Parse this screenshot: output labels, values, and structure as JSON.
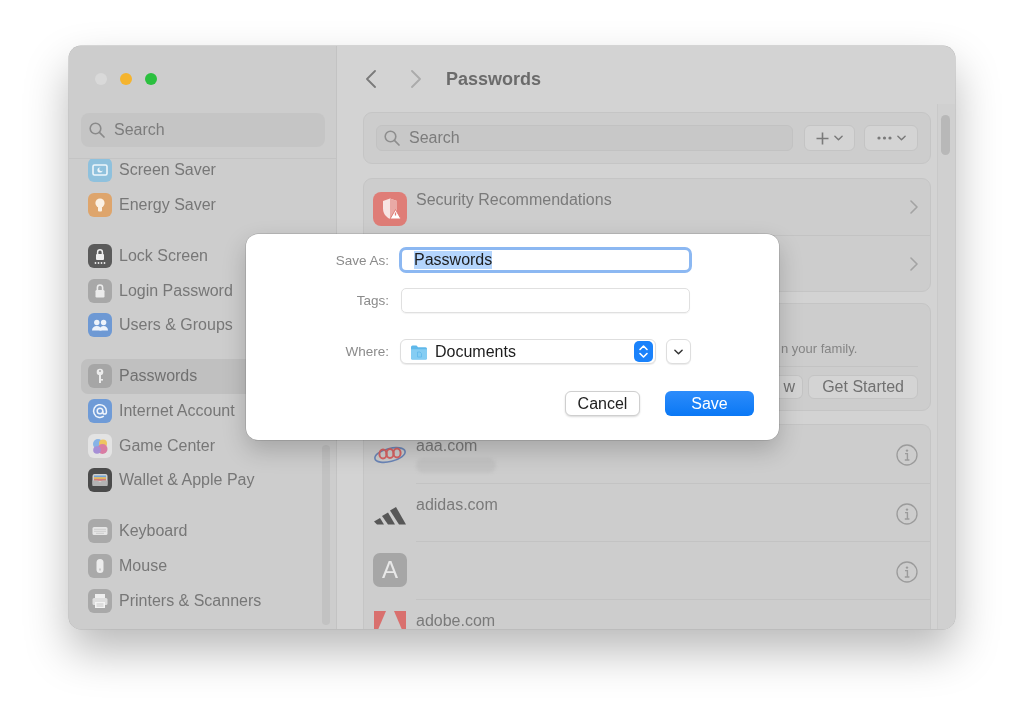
{
  "window": {
    "traffic_lights": [
      {
        "color": "#d9d9d9"
      },
      {
        "color": "#f5b42e"
      },
      {
        "color": "#2bc03f"
      }
    ]
  },
  "sidebar": {
    "search": {
      "placeholder": "Search"
    },
    "groups": [
      {
        "items": [
          {
            "label": "Screen Saver",
            "selected": false
          },
          {
            "label": "Energy Saver",
            "selected": false
          }
        ]
      },
      {
        "items": [
          {
            "label": "Lock Screen",
            "selected": false
          },
          {
            "label": "Login Password",
            "selected": false
          },
          {
            "label": "Users & Groups",
            "selected": false
          }
        ]
      },
      {
        "items": [
          {
            "label": "Passwords",
            "selected": true
          },
          {
            "label": "Internet Account",
            "selected": false
          },
          {
            "label": "Game Center",
            "selected": false
          },
          {
            "label": "Wallet & Apple Pay",
            "selected": false
          }
        ]
      },
      {
        "items": [
          {
            "label": "Keyboard",
            "selected": false
          },
          {
            "label": "Mouse",
            "selected": false
          },
          {
            "label": "Printers & Scanners",
            "selected": false
          }
        ]
      }
    ]
  },
  "toolbar": {
    "back_enabled": true,
    "forward_enabled": false,
    "title": "Passwords"
  },
  "passwords": {
    "search": {
      "placeholder": "Search"
    },
    "security_rows": [
      {
        "kind": "recommendations",
        "title": "Security Recommendations"
      },
      {
        "kind": "covered"
      }
    ],
    "family_card": {
      "text": "n your family.",
      "buttons": [
        {
          "label": "w"
        },
        {
          "label": "Get Started"
        }
      ]
    },
    "accounts": [
      {
        "kind": "logo",
        "title": "aaa.com",
        "username_blurred": true,
        "has_info": true
      },
      {
        "kind": "logo",
        "title": "adidas.com",
        "has_info": true
      },
      {
        "kind": "monogram",
        "monogram": "A",
        "has_info": true
      },
      {
        "kind": "logo",
        "title": "adobe.com"
      }
    ]
  },
  "save_dialog": {
    "save_as": {
      "label": "Save As:",
      "value": "Passwords",
      "focused": true,
      "text_selected": true
    },
    "tags": {
      "label": "Tags:"
    },
    "where": {
      "label": "Where:",
      "value": "Documents"
    },
    "buttons": [
      {
        "label": "Cancel",
        "default": false
      },
      {
        "label": "Save",
        "default": true
      }
    ]
  }
}
